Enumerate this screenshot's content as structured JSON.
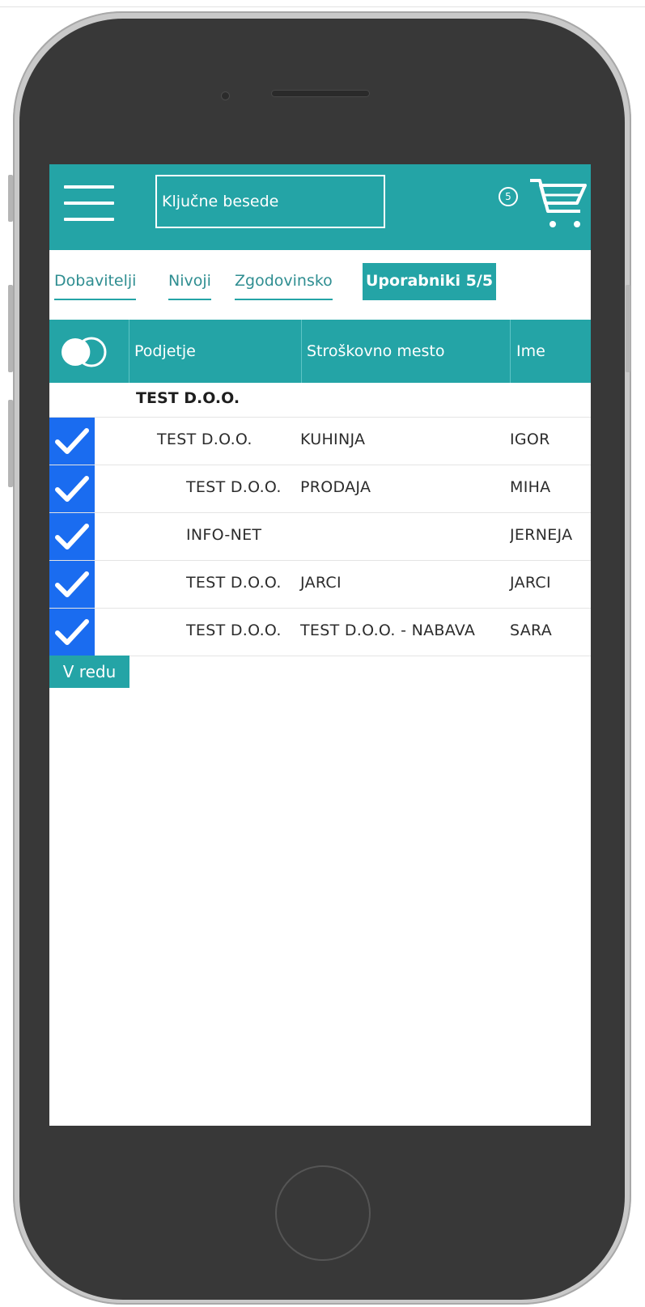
{
  "header": {
    "search_placeholder": "Ključne besede",
    "cart_count": "5"
  },
  "tabs": [
    {
      "label": "Dobavitelji",
      "active": false
    },
    {
      "label": "Nivoji",
      "active": false
    },
    {
      "label": "Zgodovinsko",
      "active": false
    },
    {
      "label": "Uporabniki 5/5",
      "active": true
    }
  ],
  "table": {
    "columns": [
      "Podjetje",
      "Stroškovno mesto",
      "Ime"
    ],
    "group_label": "TEST D.O.O.",
    "rows": [
      {
        "checked": true,
        "company": "TEST D.O.O.",
        "cost_center": "KUHINJA",
        "name": "IGOR"
      },
      {
        "checked": true,
        "company": "TEST D.O.O.",
        "cost_center": "PRODAJA",
        "name": "MIHA"
      },
      {
        "checked": true,
        "company": "INFO-NET",
        "cost_center": "",
        "name": "JERNEJA"
      },
      {
        "checked": true,
        "company": "TEST D.O.O.",
        "cost_center": "JARCI",
        "name": "JARCI"
      },
      {
        "checked": true,
        "company": "TEST D.O.O.",
        "cost_center": "TEST D.O.O. - NABAVA",
        "name": "SARA"
      }
    ]
  },
  "ok_button": "V redu",
  "colors": {
    "accent": "#24a4a6",
    "checkbox": "#1a6cf0",
    "phone_body": "#383838"
  },
  "icons": [
    "menu-icon",
    "cart-icon",
    "toggle-all-icon",
    "checkmark-icon"
  ]
}
